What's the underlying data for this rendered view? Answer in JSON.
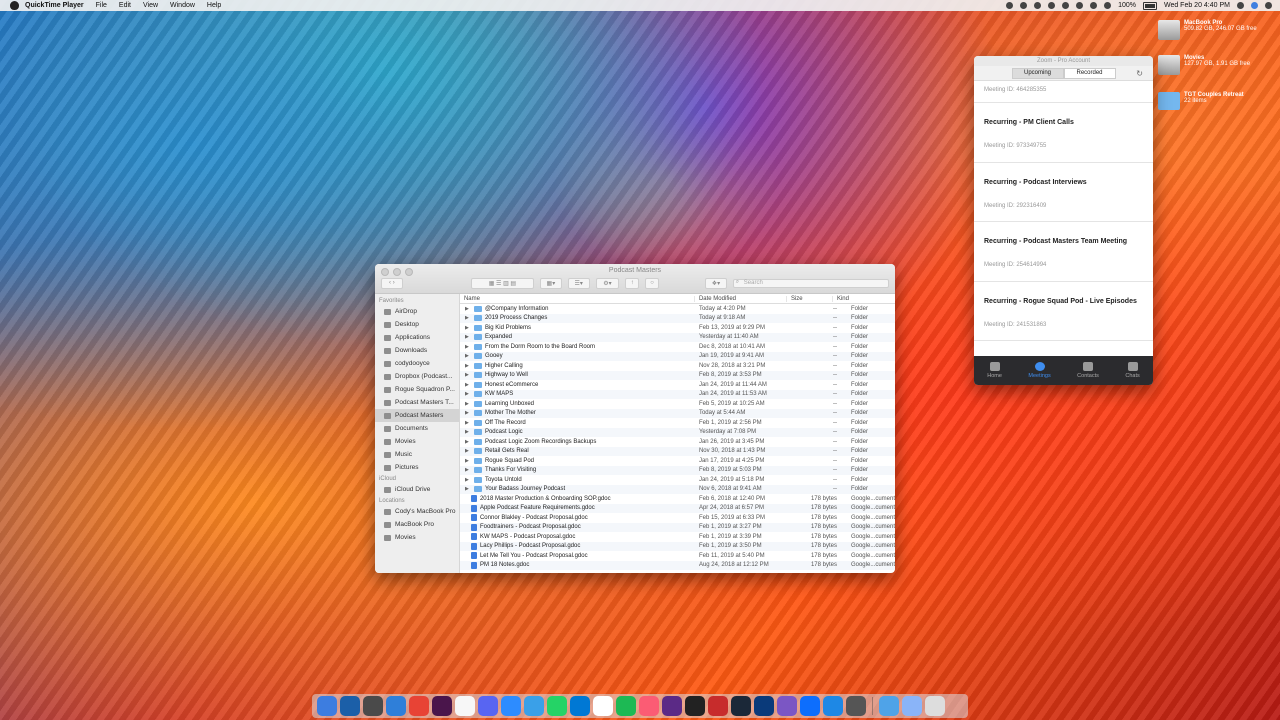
{
  "menubar": {
    "app_name": "QuickTime Player",
    "menus": [
      "File",
      "Edit",
      "View",
      "Window",
      "Help"
    ],
    "battery": "100%",
    "clock": "Wed Feb 20  4:40 PM"
  },
  "desktop_icons": [
    {
      "title": "MacBook Pro",
      "subtitle": "509.82 GB, 246.07 GB free",
      "icon": "hard-drive-icon"
    },
    {
      "title": "Movies",
      "subtitle": "127.97 GB, 1.91 GB free",
      "icon": "external-drive-icon"
    },
    {
      "title": "TGT Couples Retreat",
      "subtitle": "22 items",
      "icon": "folder-icon"
    }
  ],
  "finder": {
    "title": "Podcast Masters",
    "search_placeholder": "Search",
    "sidebar": {
      "favorites_header": "Favorites",
      "favorites": [
        "AirDrop",
        "Desktop",
        "Applications",
        "Downloads",
        "codydooyce",
        "Dropbox (Podcast...",
        "Rogue Squadron P...",
        "Podcast Masters T...",
        "Podcast Masters",
        "Documents",
        "Movies",
        "Music",
        "Pictures"
      ],
      "icloud_header": "iCloud",
      "icloud": [
        "iCloud Drive"
      ],
      "locations_header": "Locations",
      "locations": [
        "Cody's MacBook Pro",
        "MacBook Pro",
        "Movies"
      ]
    },
    "columns": {
      "name": "Name",
      "date": "Date Modified",
      "size": "Size",
      "kind": "Kind"
    },
    "rows": [
      {
        "name": "@Company Information",
        "date": "Today at 4:20 PM",
        "size": "--",
        "kind": "Folder",
        "type": "folder"
      },
      {
        "name": "2019 Process Changes",
        "date": "Today at 9:18 AM",
        "size": "--",
        "kind": "Folder",
        "type": "folder"
      },
      {
        "name": "Big Kid Problems",
        "date": "Feb 13, 2019 at 9:29 PM",
        "size": "--",
        "kind": "Folder",
        "type": "folder"
      },
      {
        "name": "Expanded",
        "date": "Yesterday at 11:40 AM",
        "size": "--",
        "kind": "Folder",
        "type": "folder"
      },
      {
        "name": "From the Dorm Room to the Board Room",
        "date": "Dec 8, 2018 at 10:41 AM",
        "size": "--",
        "kind": "Folder",
        "type": "folder"
      },
      {
        "name": "Gooey",
        "date": "Jan 19, 2019 at 9:41 AM",
        "size": "--",
        "kind": "Folder",
        "type": "folder"
      },
      {
        "name": "Higher Calling",
        "date": "Nov 28, 2018 at 3:21 PM",
        "size": "--",
        "kind": "Folder",
        "type": "folder"
      },
      {
        "name": "Highway to Well",
        "date": "Feb 8, 2019 at 3:53 PM",
        "size": "--",
        "kind": "Folder",
        "type": "folder"
      },
      {
        "name": "Honest eCommerce",
        "date": "Jan 24, 2019 at 11:44 AM",
        "size": "--",
        "kind": "Folder",
        "type": "folder"
      },
      {
        "name": "KW MAPS",
        "date": "Jan 24, 2019 at 11:53 AM",
        "size": "--",
        "kind": "Folder",
        "type": "folder"
      },
      {
        "name": "Learning Unboxed",
        "date": "Feb 5, 2019 at 10:25 AM",
        "size": "--",
        "kind": "Folder",
        "type": "folder"
      },
      {
        "name": "Mother The Mother",
        "date": "Today at 5:44 AM",
        "size": "--",
        "kind": "Folder",
        "type": "folder"
      },
      {
        "name": "Off The Record",
        "date": "Feb 1, 2019 at 2:56 PM",
        "size": "--",
        "kind": "Folder",
        "type": "folder"
      },
      {
        "name": "Podcast Logic",
        "date": "Yesterday at 7:08 PM",
        "size": "--",
        "kind": "Folder",
        "type": "folder"
      },
      {
        "name": "Podcast Logic Zoom Recordings Backups",
        "date": "Jan 26, 2019 at 3:45 PM",
        "size": "--",
        "kind": "Folder",
        "type": "folder"
      },
      {
        "name": "Retail Gets Real",
        "date": "Nov 30, 2018 at 1:43 PM",
        "size": "--",
        "kind": "Folder",
        "type": "folder"
      },
      {
        "name": "Rogue Squad Pod",
        "date": "Jan 17, 2019 at 4:25 PM",
        "size": "--",
        "kind": "Folder",
        "type": "folder"
      },
      {
        "name": "Thanks For Visiting",
        "date": "Feb 8, 2019 at 5:03 PM",
        "size": "--",
        "kind": "Folder",
        "type": "folder"
      },
      {
        "name": "Toyota Untold",
        "date": "Jan 24, 2019 at 5:18 PM",
        "size": "--",
        "kind": "Folder",
        "type": "folder"
      },
      {
        "name": "Your Badass Journey Podcast",
        "date": "Nov 6, 2018 at 9:41 AM",
        "size": "--",
        "kind": "Folder",
        "type": "folder"
      },
      {
        "name": "2018 Master Production & Onboarding SOP.gdoc",
        "date": "Feb 6, 2018 at 12:40 PM",
        "size": "178 bytes",
        "kind": "Google...cument",
        "type": "doc"
      },
      {
        "name": "Apple Podcast Feature Requirements.gdoc",
        "date": "Apr 24, 2018 at 6:57 PM",
        "size": "178 bytes",
        "kind": "Google...cument",
        "type": "doc"
      },
      {
        "name": "Connor Blakley - Podcast Proposal.gdoc",
        "date": "Feb 15, 2019 at 6:33 PM",
        "size": "178 bytes",
        "kind": "Google...cument",
        "type": "doc"
      },
      {
        "name": "Foodtrainers - Podcast Proposal.gdoc",
        "date": "Feb 1, 2019 at 3:27 PM",
        "size": "178 bytes",
        "kind": "Google...cument",
        "type": "doc"
      },
      {
        "name": "KW MAPS - Podcast Proposal.gdoc",
        "date": "Feb 1, 2019 at 3:39 PM",
        "size": "178 bytes",
        "kind": "Google...cument",
        "type": "doc"
      },
      {
        "name": "Lacy Phillips - Podcast Proposal.gdoc",
        "date": "Feb 1, 2019 at 3:50 PM",
        "size": "178 bytes",
        "kind": "Google...cument",
        "type": "doc"
      },
      {
        "name": "Let Me Tell You - Podcast Proposal.gdoc",
        "date": "Feb 11, 2019 at 5:40 PM",
        "size": "178 bytes",
        "kind": "Google...cument",
        "type": "doc"
      },
      {
        "name": "PM 18 Notes.gdoc",
        "date": "Aug 24, 2018 at 12:12 PM",
        "size": "178 bytes",
        "kind": "Google...cument",
        "type": "doc"
      }
    ]
  },
  "zoom": {
    "title": "Zoom - Pro Account",
    "tabs": [
      "Upcoming",
      "Recorded"
    ],
    "active_tab": "Upcoming",
    "first_meeting_id": "Meeting ID: 464285355",
    "meetings": [
      {
        "name": "Recurring - PM Client Calls",
        "id": "Meeting ID: 973349755"
      },
      {
        "name": "Recurring - Podcast Interviews",
        "id": "Meeting ID: 292316409"
      },
      {
        "name": "Recurring - Podcast Masters Team Meeting",
        "id": "Meeting ID: 254614994"
      },
      {
        "name": "Recurring - Rogue Squad Pod - Live Episodes",
        "id": "Meeting ID: 241531863"
      }
    ],
    "nav": [
      "Home",
      "Meetings",
      "Contacts",
      "Chats"
    ],
    "active_nav": "Meetings"
  },
  "dock_colors": [
    "#3d7de0",
    "#1b5fa8",
    "#4a4a4a",
    "#2f7fd9",
    "#e84335",
    "#4a154b",
    "#f7f7f7",
    "#5865f2",
    "#2d8cff",
    "#3aa0e8",
    "#25d366",
    "#0078d4",
    "#ffffff",
    "#1db954",
    "#fb5c74",
    "#5b2a86",
    "#222222",
    "#c72c2c",
    "#1b2838",
    "#0a3a7a",
    "#7b56c4",
    "#0d6efd",
    "#1e88e5",
    "#555555",
    "#4fa3e8",
    "#8ab4f8",
    "#dddddd"
  ]
}
